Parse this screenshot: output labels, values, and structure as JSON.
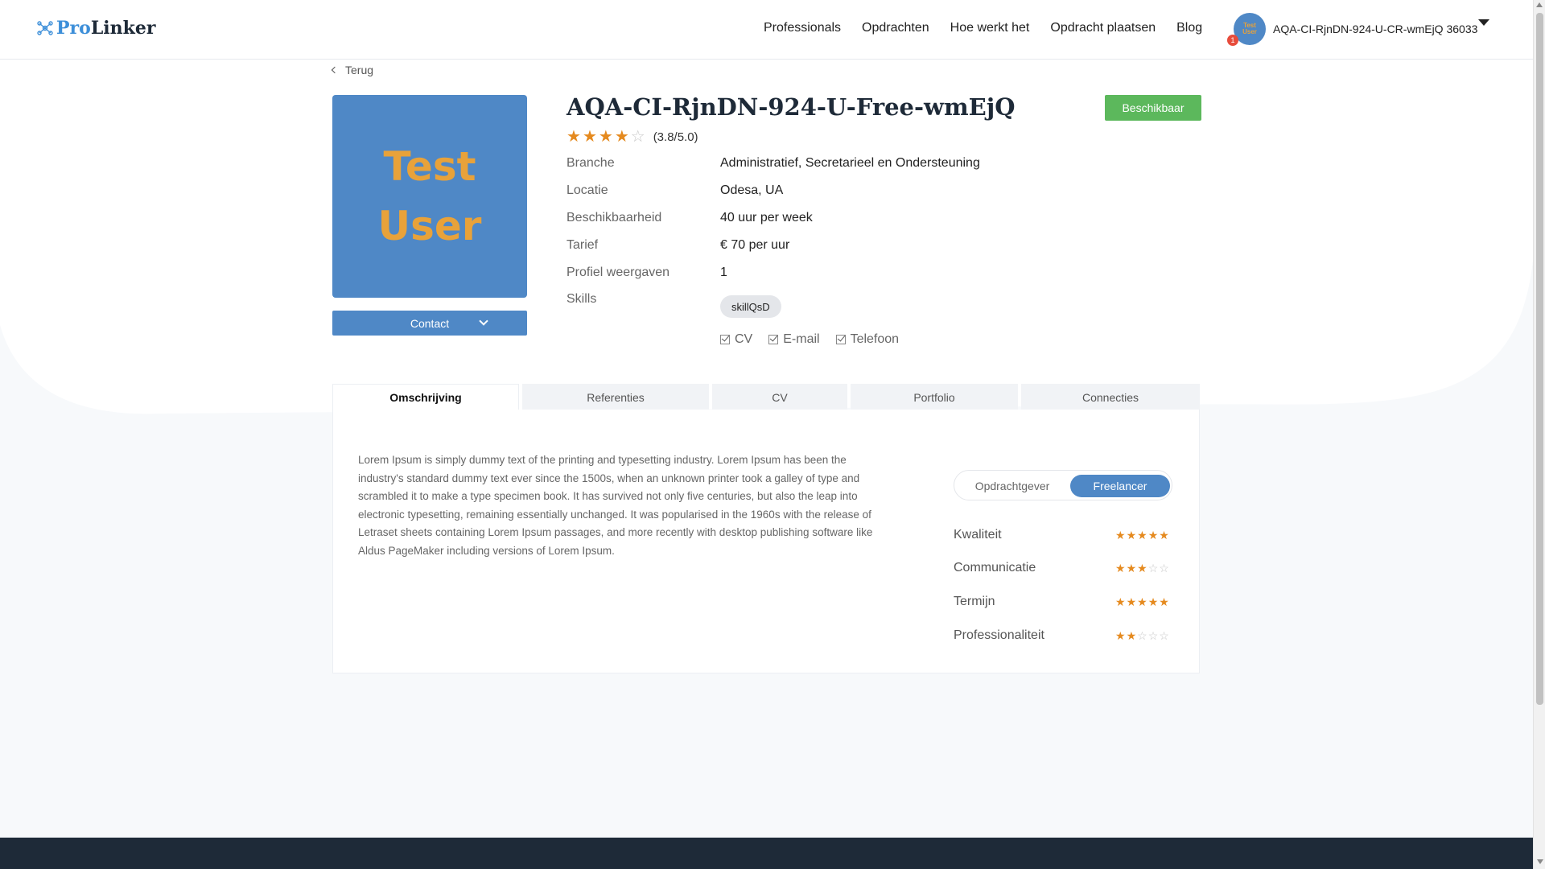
{
  "header": {
    "logo_pro": "Pro",
    "logo_linker": "Linker",
    "nav": [
      "Professionals",
      "Opdrachten",
      "Hoe werkt het",
      "Opdracht plaatsen",
      "Blog"
    ],
    "avatar_line1": "Test",
    "avatar_line2": "User",
    "notification_count": "1",
    "user_name": "AQA-CI-RjnDN-924-U-CR-wmEjQ 36033"
  },
  "back_label": "Terug",
  "profile": {
    "image_line1": "Test",
    "image_line2": "User",
    "contact_label": "Contact",
    "name": "AQA-CI-RjnDN-924-U-Free-wmEjQ",
    "rating_value": 3.8,
    "rating_text": "(3.8/5.0)",
    "status_label": "Beschikbaar",
    "status_color": "#5cb85c",
    "info": [
      {
        "label": "Branche",
        "value": "Administratief, Secretarieel en Ondersteuning"
      },
      {
        "label": "Locatie",
        "value": "Odesa, UA"
      },
      {
        "label": "Beschikbaarheid",
        "value": "40 uur per week"
      },
      {
        "label": "Tarief",
        "value": "€ 70 per uur"
      },
      {
        "label": "Profiel weergaven",
        "value": "1"
      },
      {
        "label": "Skills",
        "value": ""
      }
    ],
    "skills": [
      "skillQsD"
    ],
    "documents": [
      "CV",
      "E-mail",
      "Telefoon"
    ]
  },
  "tabs": [
    {
      "label": "Omschrijving",
      "active": true
    },
    {
      "label": "Referenties",
      "active": false
    },
    {
      "label": "CV",
      "active": false
    },
    {
      "label": "Portfolio",
      "active": false
    },
    {
      "label": "Connecties",
      "active": false
    }
  ],
  "description": "Lorem Ipsum is simply dummy text of the printing and typesetting industry. Lorem Ipsum has been the industry's standard dummy text ever since the 1500s, when an unknown printer took a galley of type and scrambled it to make a type specimen book. It has survived not only five centuries, but also the leap into electronic typesetting, remaining essentially unchanged. It was popularised in the 1960s with the release of Letraset sheets containing Lorem Ipsum passages, and more recently with desktop publishing software like Aldus PageMaker including versions of Lorem Ipsum.",
  "toggle": {
    "left": "Opdrachtgever",
    "right": "Freelancer",
    "selected": "Freelancer"
  },
  "criteria": [
    {
      "label": "Kwaliteit",
      "stars": 5
    },
    {
      "label": "Communicatie",
      "stars": 3
    },
    {
      "label": "Termijn",
      "stars": 5
    },
    {
      "label": "Professionaliteit",
      "stars": 2
    }
  ],
  "colors": {
    "accent": "#4f88c6",
    "star": "#e58a1f",
    "footer": "#1e2a38"
  }
}
